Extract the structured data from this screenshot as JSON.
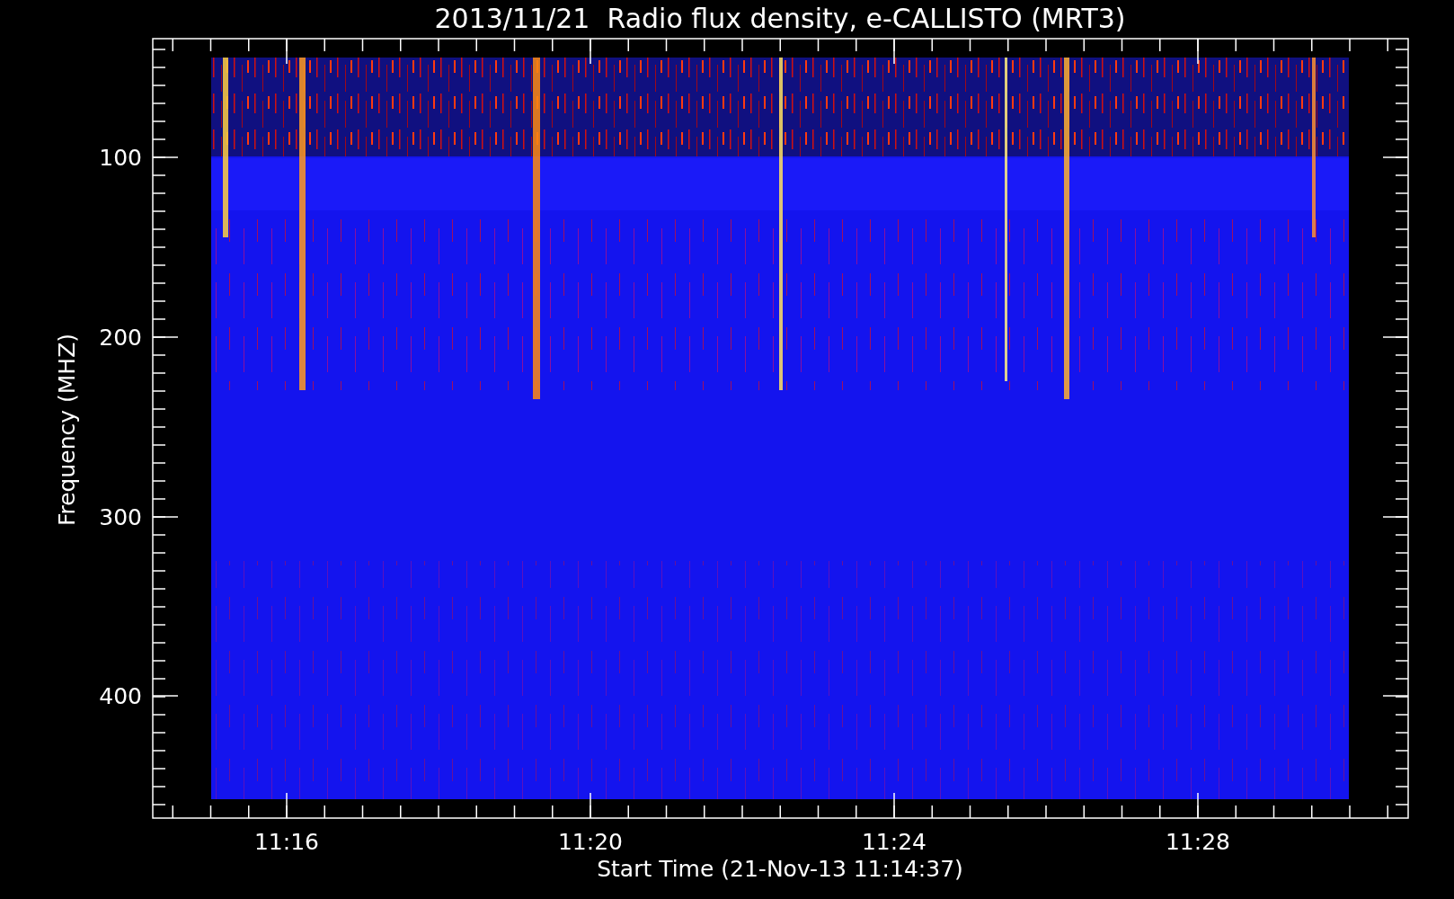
{
  "chart": {
    "title": "2013/11/21  Radio flux density, e-CALLISTO (MRT3)",
    "ylabel": "Frequency (MHZ)",
    "xlabel": "Start Time (21-Nov-13 11:14:37)",
    "yticks": [
      "100",
      "200",
      "300",
      "400"
    ],
    "xticks": [
      "11:16",
      "11:20",
      "11:24",
      "11:28"
    ]
  }
}
